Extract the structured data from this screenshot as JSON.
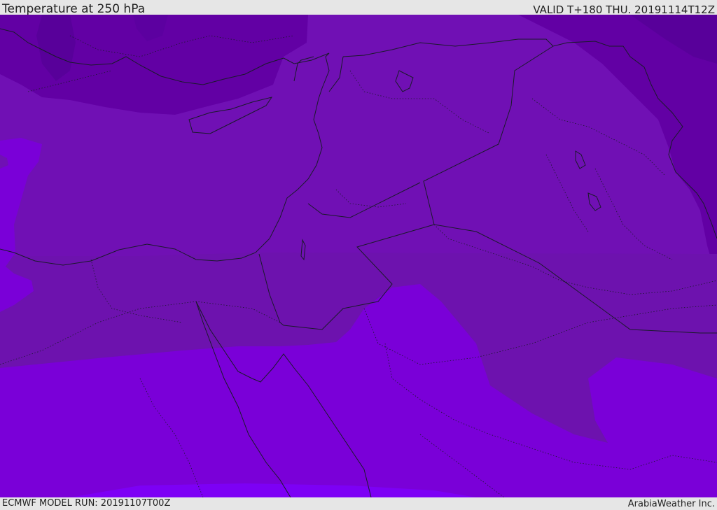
{
  "header": {
    "title": "Temperature at 250 hPa",
    "valid_time": "VALID T+180 THU. 20191114T12Z"
  },
  "footer": {
    "model_run": "ECMWF MODEL RUN: 20191107T00Z",
    "credit": "ArabiaWeather Inc."
  },
  "colors": {
    "band_coldest": "#58009a",
    "band_cold": "#6200a4",
    "band_mid": "#7010b4",
    "band_mid_alt": "#6d12ae",
    "band_warm": "#7a00d8",
    "band_warmest": "#7d00f5",
    "border_line": "#1a1a2a",
    "frame_background": "#e6e6e6"
  }
}
